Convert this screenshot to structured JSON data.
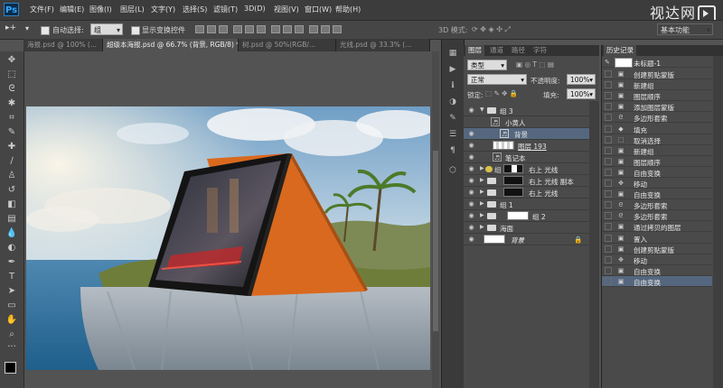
{
  "app": {
    "logo": "Ps",
    "watermark": "视达网"
  },
  "menu": [
    "文件(F)",
    "编辑(E)",
    "图像(I)",
    "图层(L)",
    "文字(Y)",
    "选择(S)",
    "滤镜(T)",
    "3D(D)",
    "视图(V)",
    "窗口(W)",
    "帮助(H)"
  ],
  "options": {
    "auto_select_label": "自动选择:",
    "auto_select_value": "组",
    "show_transform_label": "显示变换控件",
    "mode_3d_label": "3D 模式:",
    "workspace_value": "基本功能"
  },
  "doc_tabs": [
    "海报.psd @ 100% (...",
    "超级本海报.psd @ 66.7% (背景, RGB/8) *",
    "树.psd @ 50%(RGB/...",
    "光线.psd @ 33.3% (..."
  ],
  "layers_panel": {
    "tabs": [
      "图层",
      "通道",
      "路径",
      "字符"
    ],
    "kind_value": "类型",
    "blend_value": "正常",
    "opacity_label": "不透明度:",
    "opacity_value": "100%",
    "lock_label": "锁定:",
    "fill_label": "填充:",
    "fill_value": "100%",
    "layers": [
      {
        "name": "组 3"
      },
      {
        "name": "小黄人"
      },
      {
        "name": "背景"
      },
      {
        "name": "图层 193"
      },
      {
        "name": "笔记本"
      },
      {
        "name": "右上 光线"
      },
      {
        "name": "右上 光线 副本"
      },
      {
        "name": "右上 光线"
      },
      {
        "name": "组 1"
      },
      {
        "name": "组 2"
      },
      {
        "name": "海面"
      },
      {
        "name": "背景"
      }
    ]
  },
  "history_panel": {
    "tab": "历史记录",
    "snapshot": "未标题-1",
    "items": [
      "创建剪贴蒙版",
      "新建组",
      "图层顺序",
      "添加图层蒙版",
      "多边形套索",
      "填充",
      "取消选择",
      "新建组",
      "图层顺序",
      "自由变换",
      "移动",
      "自由变换",
      "多边形套索",
      "多边形套索",
      "通过拷贝的图层",
      "置入",
      "创建剪贴蒙版",
      "移动",
      "自由变换",
      "自由变换"
    ],
    "selected_index": 19
  },
  "colors": {
    "selection": "#55677f",
    "laptop_orange": "#d9691e",
    "ps_blue": "#31a8ff"
  }
}
